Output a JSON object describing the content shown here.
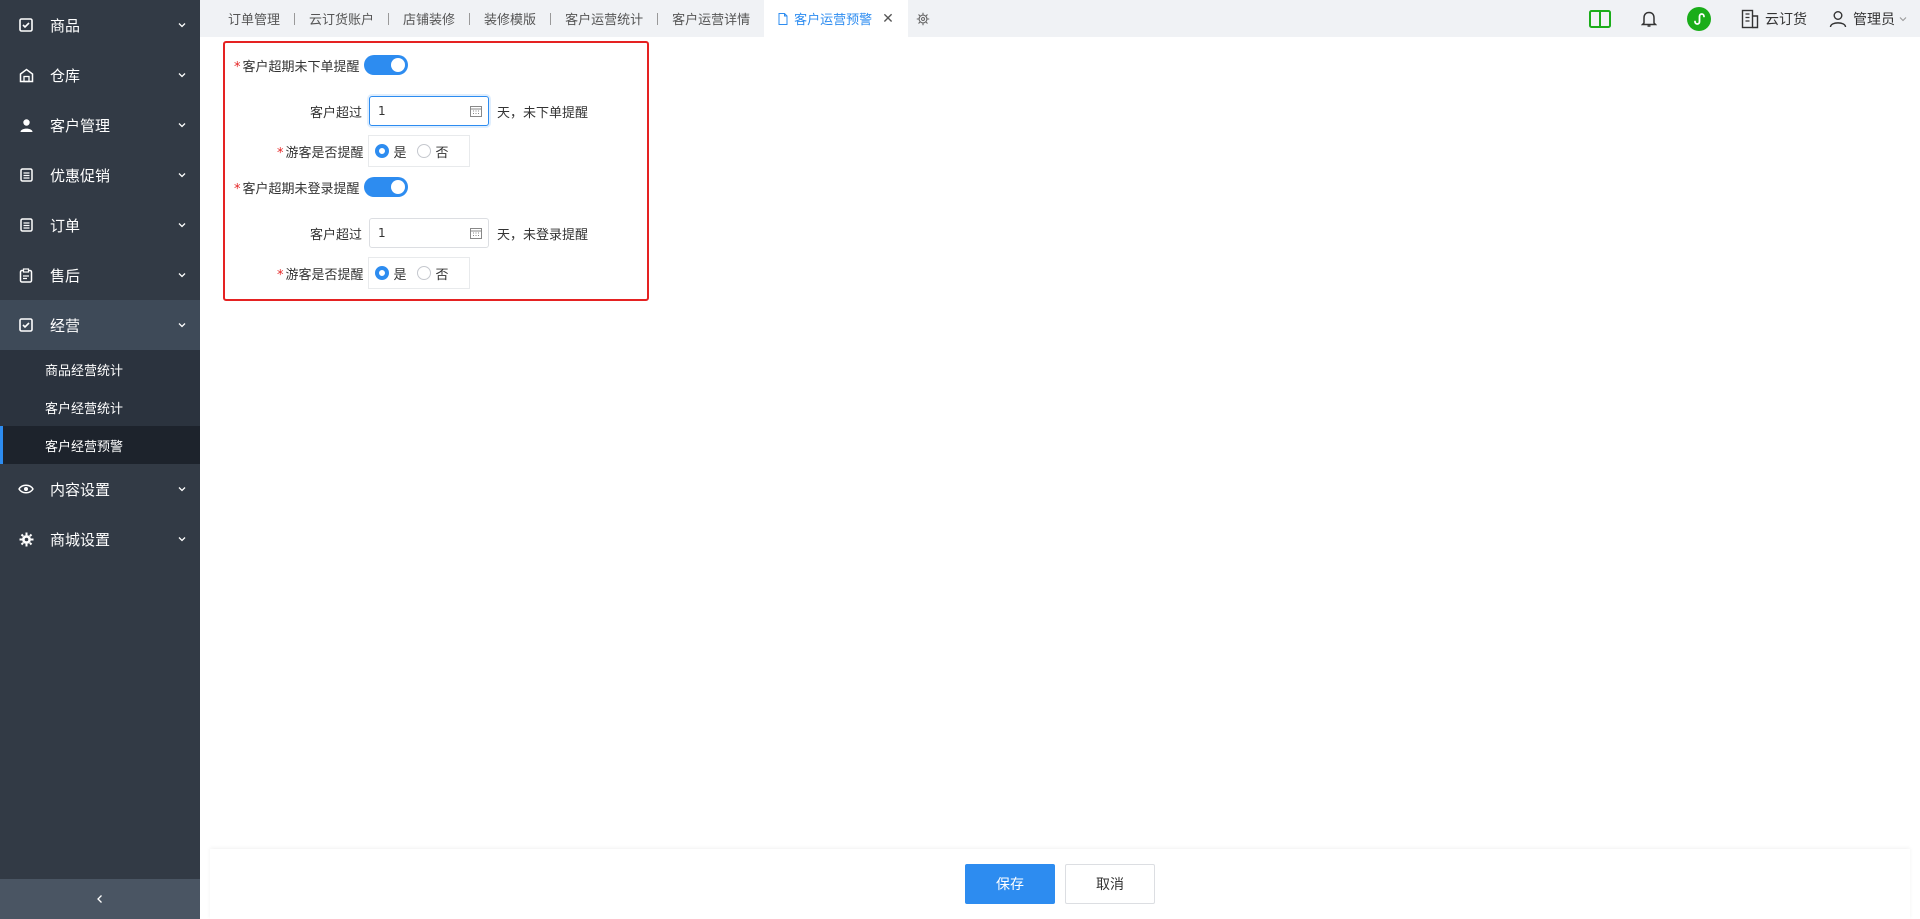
{
  "sidebar": {
    "items": [
      {
        "label": "商品",
        "icon": "check-square-icon"
      },
      {
        "label": "仓库",
        "icon": "warehouse-icon"
      },
      {
        "label": "客户管理",
        "icon": "user-icon"
      },
      {
        "label": "优惠促销",
        "icon": "list-icon"
      },
      {
        "label": "订单",
        "icon": "list-icon"
      },
      {
        "label": "售后",
        "icon": "clipboard-icon"
      },
      {
        "label": "经营",
        "icon": "check-square-icon"
      },
      {
        "label": "内容设置",
        "icon": "eye-icon"
      },
      {
        "label": "商城设置",
        "icon": "gear-icon"
      }
    ],
    "submenu": [
      "商品经营统计",
      "客户经营统计",
      "客户经营预警"
    ]
  },
  "tabs": [
    "订单管理",
    "云订货账户",
    "店铺装修",
    "装修模版",
    "客户运营统计",
    "客户运营详情",
    "客户运营预警"
  ],
  "header": {
    "org": "云订货",
    "user": "管理员"
  },
  "form": {
    "order_switch_label": "客户超期未下单提醒",
    "exceed_label": "客户超过",
    "order_days": "1",
    "order_suffix": "天，未下单提醒",
    "guest_label": "游客是否提醒",
    "yes": "是",
    "no": "否",
    "login_switch_label": "客户超期未登录提醒",
    "login_days": "1",
    "login_suffix": "天，未登录提醒"
  },
  "footer": {
    "save": "保存",
    "cancel": "取消"
  },
  "colors": {
    "accent": "#2d8cf0",
    "sidebar": "#323a45",
    "highlight_box": "#e52222"
  }
}
